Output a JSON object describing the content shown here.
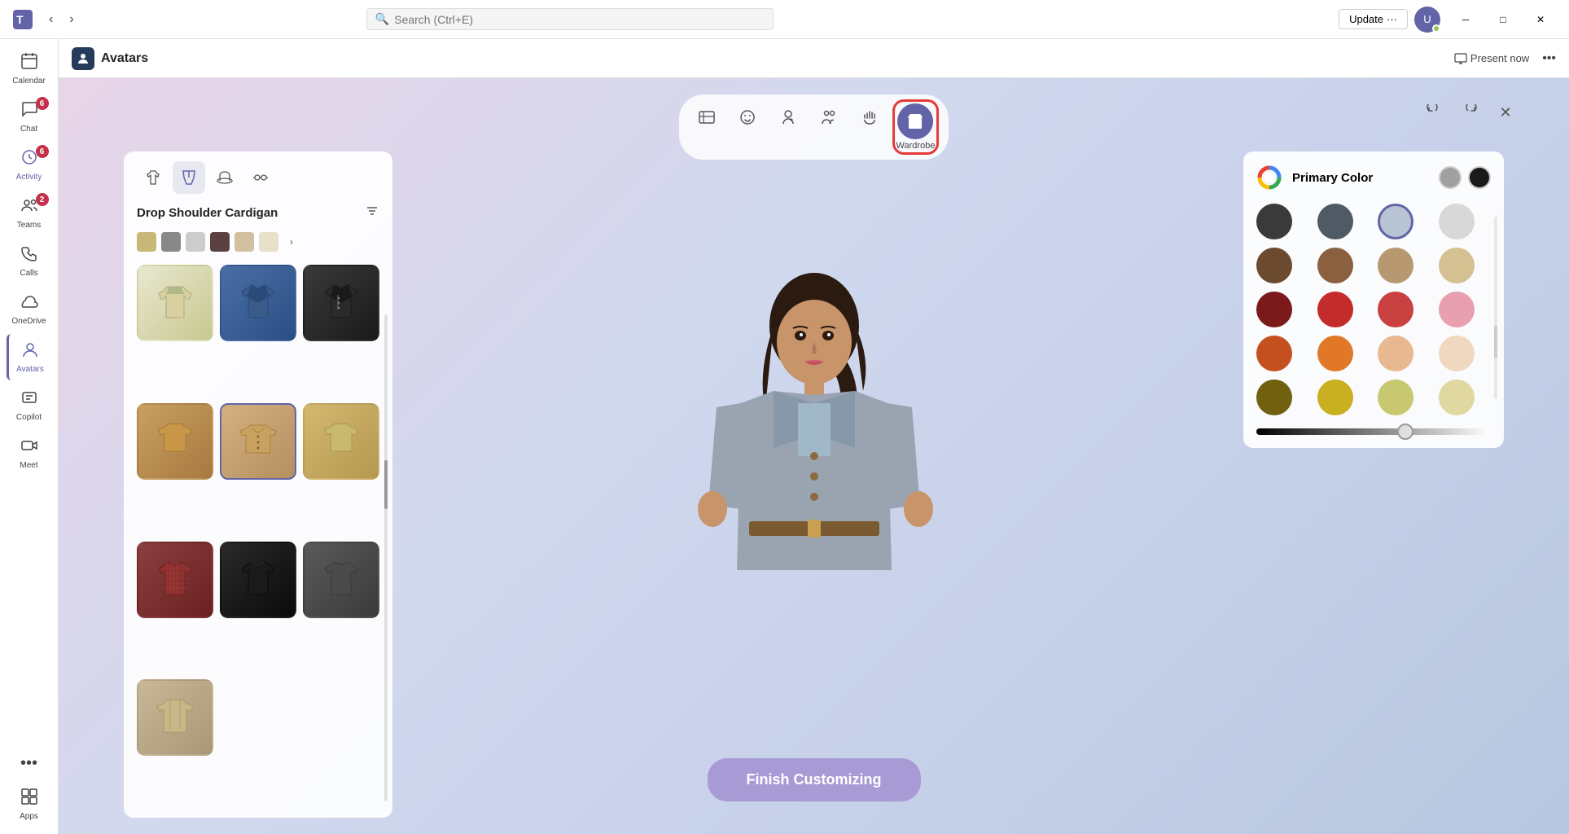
{
  "titlebar": {
    "search_placeholder": "Search (Ctrl+E)",
    "update_label": "Update",
    "more_label": "···"
  },
  "page": {
    "title": "Avatars",
    "icon": "👤",
    "present_now": "Present now"
  },
  "sidebar": {
    "items": [
      {
        "id": "calendar",
        "label": "Calendar",
        "icon": "📅",
        "badge": null
      },
      {
        "id": "chat",
        "label": "Chat",
        "icon": "💬",
        "badge": "6"
      },
      {
        "id": "activity",
        "label": "Activity",
        "icon": "🔔",
        "badge": "6"
      },
      {
        "id": "teams",
        "label": "Teams",
        "icon": "👥",
        "badge": "2"
      },
      {
        "id": "calls",
        "label": "Calls",
        "icon": "📞",
        "badge": null
      },
      {
        "id": "onedrive",
        "label": "OneDrive",
        "icon": "☁",
        "badge": null
      },
      {
        "id": "avatars",
        "label": "Avatars",
        "icon": "🧑",
        "badge": null,
        "active": true
      },
      {
        "id": "copilot",
        "label": "Copilot",
        "icon": "✨",
        "badge": null
      },
      {
        "id": "meet",
        "label": "Meet",
        "icon": "🎥",
        "badge": null
      },
      {
        "id": "more",
        "label": "···",
        "icon": "···",
        "badge": null
      },
      {
        "id": "apps",
        "label": "Apps",
        "icon": "⊞",
        "badge": null
      }
    ]
  },
  "toolbar": {
    "buttons": [
      {
        "id": "reactions",
        "icon": "💬",
        "label": ""
      },
      {
        "id": "face",
        "icon": "😊",
        "label": ""
      },
      {
        "id": "expressions",
        "icon": "🎭",
        "label": ""
      },
      {
        "id": "body",
        "icon": "👥",
        "label": ""
      },
      {
        "id": "gestures",
        "icon": "✋",
        "label": ""
      },
      {
        "id": "wardrobe",
        "icon": "👕",
        "label": "Wardrobe",
        "active": true
      }
    ],
    "right_buttons": [
      {
        "id": "undo",
        "icon": "↩"
      },
      {
        "id": "redo",
        "icon": "↪"
      },
      {
        "id": "close",
        "icon": "✕"
      }
    ]
  },
  "wardrobe_panel": {
    "tabs": [
      {
        "id": "top",
        "icon": "👕"
      },
      {
        "id": "pants",
        "icon": "👖",
        "active": true
      },
      {
        "id": "hat",
        "icon": "🎩"
      },
      {
        "id": "glasses",
        "icon": "👓"
      }
    ],
    "title": "Drop Shoulder Cardigan",
    "items": [
      {
        "id": "hoodie",
        "class": "cloth-hoodie"
      },
      {
        "id": "blue-jacket",
        "class": "cloth-jacket"
      },
      {
        "id": "dark-jacket",
        "class": "cloth-dark-jacket"
      },
      {
        "id": "tan",
        "class": "cloth-tan"
      },
      {
        "id": "selected-cardigan",
        "class": "cloth-selected",
        "selected": true
      },
      {
        "id": "beige",
        "class": "cloth-beige"
      },
      {
        "id": "plaid",
        "class": "cloth-plaid"
      },
      {
        "id": "black",
        "class": "cloth-black"
      },
      {
        "id": "charcoal",
        "class": "cloth-charcoal"
      },
      {
        "id": "coat",
        "class": "cloth-coat"
      }
    ]
  },
  "color_panel": {
    "title": "Primary Color",
    "colors": [
      {
        "id": "c1",
        "hex": "#3a3a3a"
      },
      {
        "id": "c2",
        "hex": "#505a64"
      },
      {
        "id": "c3",
        "hex": "#b8c4d4",
        "selected": true
      },
      {
        "id": "c4",
        "hex": "#d8d8d8"
      },
      {
        "id": "c5",
        "hex": "#6b4a30"
      },
      {
        "id": "c6",
        "hex": "#8b6040"
      },
      {
        "id": "c7",
        "hex": "#b89870"
      },
      {
        "id": "c8",
        "hex": "#d4c090"
      },
      {
        "id": "c9",
        "hex": "#7a1a1a"
      },
      {
        "id": "c10",
        "hex": "#c42b2b"
      },
      {
        "id": "c11",
        "hex": "#c84040"
      },
      {
        "id": "c12",
        "hex": "#e8a0b0"
      },
      {
        "id": "c13",
        "hex": "#c45020"
      },
      {
        "id": "c14",
        "hex": "#e07828"
      },
      {
        "id": "c15",
        "hex": "#e8b890"
      },
      {
        "id": "c16",
        "hex": "#f0d8c0"
      },
      {
        "id": "c17",
        "hex": "#706010"
      },
      {
        "id": "c18",
        "hex": "#c8b020"
      },
      {
        "id": "c19",
        "hex": "#c8c870"
      },
      {
        "id": "c20",
        "hex": "#e0d8a0"
      }
    ],
    "primary_swatches": [
      {
        "id": "ps1",
        "hex": "#808080"
      },
      {
        "id": "ps2",
        "hex": "#1a1a1a"
      }
    ]
  },
  "finish_button": {
    "label": "Finish Customizing"
  }
}
